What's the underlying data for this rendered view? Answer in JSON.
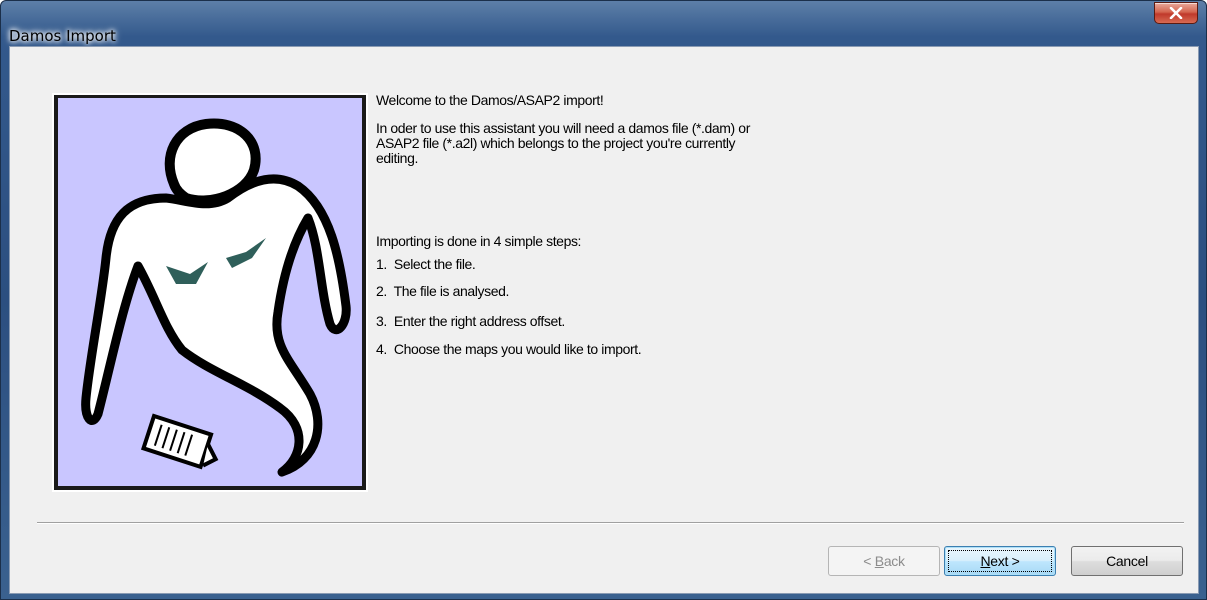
{
  "window": {
    "title": "Damos Import"
  },
  "content": {
    "welcome": "Welcome to the Damos/ASAP2 import!",
    "intro_line1": "In oder to use this assistant you will need a damos file (*.dam) or",
    "intro_line2": "ASAP2 file (*.a2l) which belongs to the project you're currently",
    "intro_line3": "editing.",
    "steps_intro": "Importing is done in 4 simple steps:",
    "steps": [
      {
        "number": "1.",
        "text": "Select the file."
      },
      {
        "number": "2.",
        "text": "The file is analysed."
      },
      {
        "number": "3.",
        "text": "Enter the right address offset."
      },
      {
        "number": "4.",
        "text": "Choose the maps you would like to import."
      }
    ]
  },
  "buttons": {
    "back_prefix": "< ",
    "back_mnemonic": "B",
    "back_rest": "ack",
    "next_mnemonic": "N",
    "next_rest": "ext >",
    "cancel": "Cancel"
  },
  "art": {
    "icon": "ghost-illustration",
    "background_color": "#c9c6ff",
    "accent_color": "#2f5f5a"
  },
  "colors": {
    "close_button": "#c0392b",
    "dialog_background": "#f0f0f0",
    "titlebar": "#33598c"
  }
}
